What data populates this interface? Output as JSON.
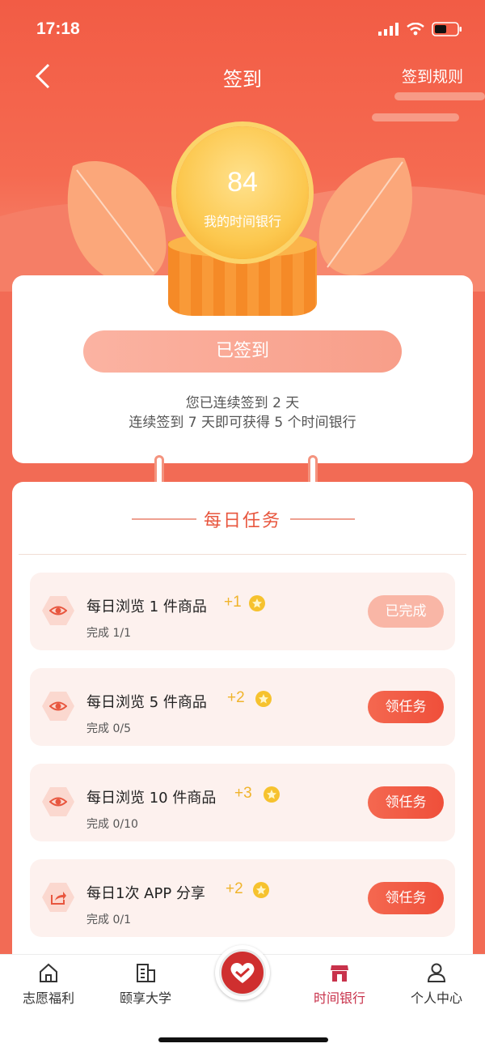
{
  "status_bar": {
    "time": "17:18"
  },
  "nav": {
    "title": "签到",
    "rules_label": "签到规则"
  },
  "coin": {
    "value": "84",
    "label": "我的时间银行"
  },
  "signin": {
    "button_label": "已签到",
    "streak_line1": "您已连续签到 2 天",
    "streak_line2": "连续签到 7 天即可获得 5 个时间银行"
  },
  "daily": {
    "title": "每日任务",
    "tasks": [
      {
        "title": "每日浏览 1 件商品",
        "reward": "+1",
        "progress": "完成 1/1",
        "button": "已完成",
        "icon": "eye-icon"
      },
      {
        "title": "每日浏览 5 件商品",
        "reward": "+2",
        "progress": "完成 0/5",
        "button": "领任务",
        "icon": "eye-icon"
      },
      {
        "title": "每日浏览 10 件商品",
        "reward": "+3",
        "progress": "完成 0/10",
        "button": "领任务",
        "icon": "eye-icon"
      },
      {
        "title": "每日1次 APP 分享",
        "reward": "+2",
        "progress": "完成 0/1",
        "button": "领任务",
        "icon": "share-icon"
      }
    ]
  },
  "tabbar": {
    "items": [
      {
        "label": "志愿福利",
        "icon": "home-icon"
      },
      {
        "label": "颐享大学",
        "icon": "building-icon"
      },
      {
        "label": "",
        "icon": "heart-hand-icon"
      },
      {
        "label": "时间银行",
        "icon": "shop-icon"
      },
      {
        "label": "个人中心",
        "icon": "person-icon"
      }
    ],
    "active_color": "#c8324b"
  },
  "colors": {
    "primary": "#f25c45",
    "reward": "#f0b42c"
  }
}
